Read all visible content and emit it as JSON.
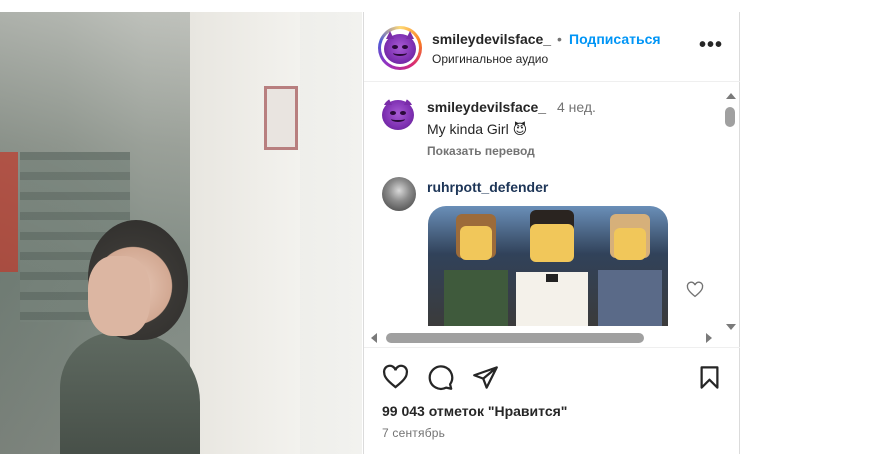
{
  "post": {
    "username": "smileydevilsface_",
    "separator": "•",
    "follow_label": "Подписаться",
    "audio_label": "Оригинальное аудио",
    "more_label": "•••"
  },
  "comments": [
    {
      "username": "smileydevilsface_",
      "time": "4 нед.",
      "text": "My kinda Girl 😈",
      "translate_label": "Показать перевод"
    },
    {
      "username": "ruhrpott_defender",
      "attachment": "gif"
    }
  ],
  "actions": {
    "likes_text": "99 043 отметок \"Нравится\"",
    "date_text": "7 сентябрь"
  },
  "icons": {
    "like": "heart-icon",
    "comment": "comment-icon",
    "share": "send-icon",
    "save": "bookmark-icon",
    "more": "more-icon"
  },
  "colors": {
    "accent": "#0095f6",
    "text": "#262626",
    "muted": "#737373"
  }
}
